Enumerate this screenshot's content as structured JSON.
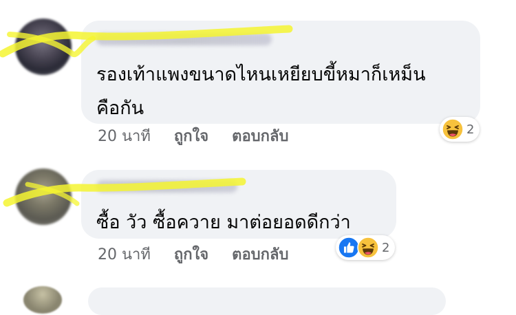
{
  "comments": [
    {
      "text": "รองเท้าแพงขนาดไหนเหยียบขี้หมาก็เหม็น\nคือกัน",
      "time": "20 นาที",
      "like_label": "ถูกใจ",
      "reply_label": "ตอบกลับ",
      "reactions": {
        "icons": [
          "haha-icon"
        ],
        "count": "2"
      }
    },
    {
      "text": "ซื้อ วัว ซื้อควาย มาต่อยอดดีกว่า",
      "time": "20 นาที",
      "like_label": "ถูกใจ",
      "reply_label": "ตอบกลับ",
      "reactions": {
        "icons": [
          "like-icon",
          "haha-icon"
        ],
        "count": "2"
      }
    }
  ],
  "colors": {
    "bubble": "#f0f2f5",
    "highlighter": "#f5f531",
    "like_blue": "#1877f2",
    "haha_yellow": "#f7c23d"
  }
}
